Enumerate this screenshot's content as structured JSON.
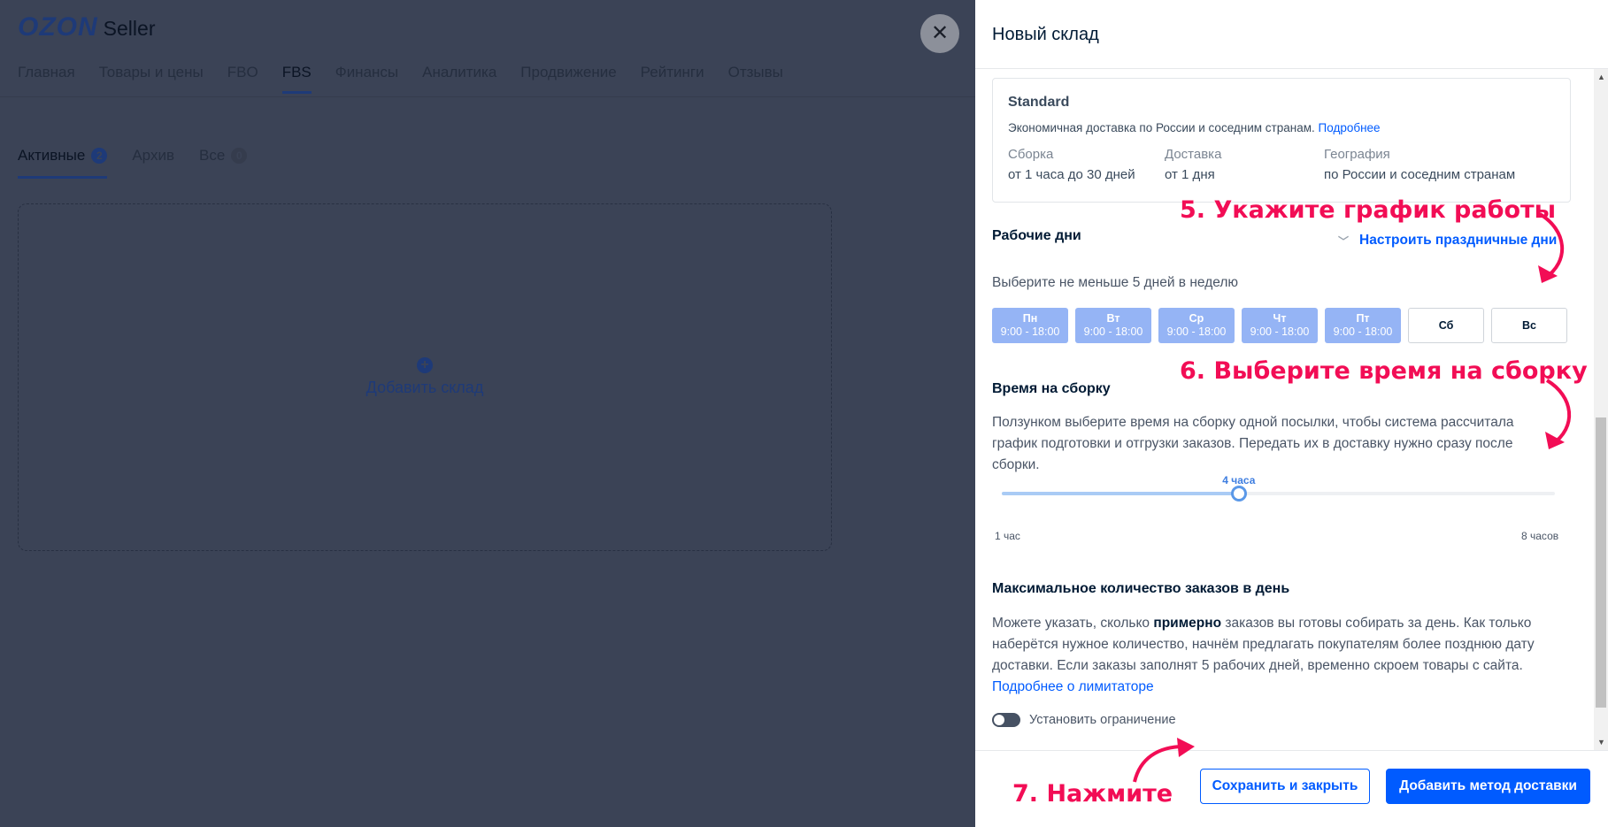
{
  "background": {
    "logo": {
      "brand": "OZON",
      "product": "Seller"
    },
    "nav": [
      "Главная",
      "Товары и цены",
      "FBO",
      "FBS",
      "Финансы",
      "Аналитика",
      "Продвижение",
      "Рейтинги",
      "Отзывы"
    ],
    "nav_active": "FBS",
    "tabs": [
      {
        "label": "Активные",
        "count": "2"
      },
      {
        "label": "Архив",
        "count": ""
      },
      {
        "label": "Все",
        "count": "0"
      }
    ],
    "add_warehouse": "Добавить склад"
  },
  "close_icon": "close-icon",
  "panel": {
    "title": "Новый склад",
    "standard": {
      "title": "Standard",
      "description": "Экономичная доставка по России и соседним странам.",
      "more_link": "Подробнее",
      "columns": [
        {
          "key": "Сборка",
          "value": "от 1 часа до 30 дней"
        },
        {
          "key": "Доставка",
          "value": "от 1 дня"
        },
        {
          "key": "География",
          "value": "по России и соседним странам"
        }
      ]
    },
    "work_days": {
      "title": "Рабочие дни",
      "holiday_link": "Настроить праздничные дни",
      "hint": "Выберите не меньше 5 дней в неделю",
      "days": [
        {
          "name": "Пн",
          "hours": "9:00 - 18:00",
          "selected": true
        },
        {
          "name": "Вт",
          "hours": "9:00 - 18:00",
          "selected": true
        },
        {
          "name": "Ср",
          "hours": "9:00 - 18:00",
          "selected": true
        },
        {
          "name": "Чт",
          "hours": "9:00 - 18:00",
          "selected": true
        },
        {
          "name": "Пт",
          "hours": "9:00 - 18:00",
          "selected": true
        },
        {
          "name": "Сб",
          "hours": "",
          "selected": false
        },
        {
          "name": "Вс",
          "hours": "",
          "selected": false
        }
      ]
    },
    "assembly_time": {
      "title": "Время на сборку",
      "description_1": "Ползунком выберите время на сборку одной посылки, чтобы система рассчитала",
      "description_2": "график подготовки и отгрузки заказов. Передать их в доставку нужно сразу после",
      "description_3": "сборки.",
      "slider_value_label": "4 часа",
      "slider_value": 4,
      "slider_min": 1,
      "slider_max": 8,
      "min_label": "1 час",
      "max_label": "8 часов"
    },
    "max_orders": {
      "title": "Максимальное количество заказов в день",
      "line1_pre": "Можете указать, сколько ",
      "line1_bold": "примерно",
      "line1_post": " заказов вы готовы собирать за день. Как только",
      "line2": "наберётся нужное количество, начнём предлагать покупателям более позднюю дату",
      "line3": "доставки. Если заказы заполнят 5 рабочих дней, временно скроем товары с сайта.",
      "link": "Подробнее о лимитаторе",
      "toggle_label": "Установить ограничение",
      "toggle_on": false
    },
    "buttons": {
      "save_close": "Сохранить и закрыть",
      "add_method": "Добавить метод доставки"
    }
  },
  "annotations": {
    "step5": "5. Укажите график работы",
    "step6": "6. Выберите время на сборку",
    "step7": "7. Нажмите",
    "color": "#f20d55"
  }
}
